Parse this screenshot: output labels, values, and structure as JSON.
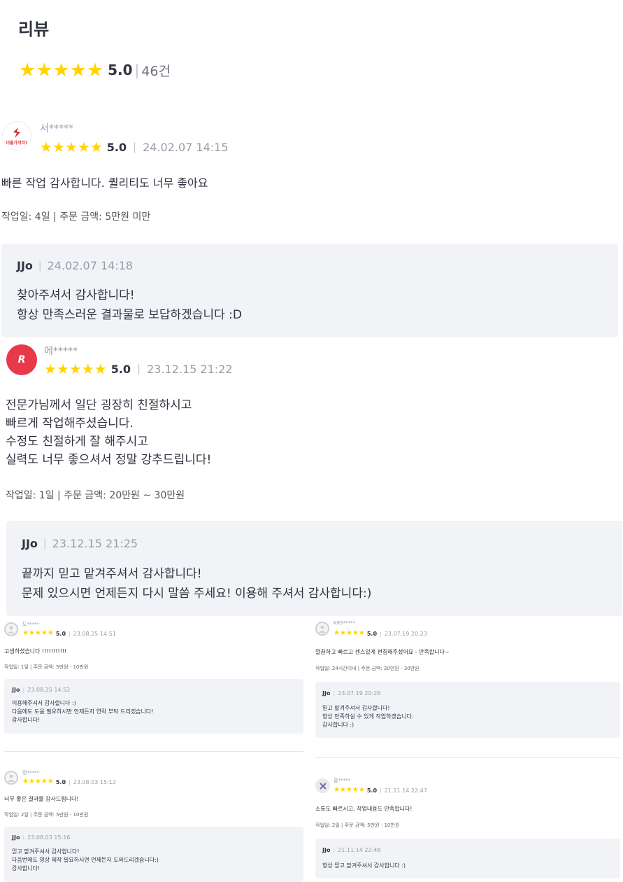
{
  "header": {
    "title": "리뷰",
    "rating": "5.0",
    "count": "46건"
  },
  "reviews": [
    {
      "user": "서*****",
      "rating": "5.0",
      "date": "24.02.07 14:15",
      "content": [
        "빠른 작업 감사합니다. 퀄리티도 너무 좋아요"
      ],
      "meta": "작업일: 4일 | 주문 금액: 5만원 미만",
      "avatar_text": "더올가치티?",
      "reply": {
        "author": "JJo",
        "date": "24.02.07 14:18",
        "content": [
          "찾아주셔서 감사합니다!",
          "항상 만족스러운 결과물로 보답하겠습니다 :D"
        ]
      }
    },
    {
      "user": "에*****",
      "rating": "5.0",
      "date": "23.12.15 21:22",
      "content": [
        "전문가님께서 일단 굉장히 친절하시고",
        "빠르게 작업해주셨습니다.",
        "수정도 친절하게 잘 해주시고",
        "실력도 너무 좋으셔서 정말 강추드립니다!"
      ],
      "meta": "작업일: 1일 | 주문 금액: 20만원 ~ 30만원",
      "avatar_text": "R",
      "reply": {
        "author": "JJo",
        "date": "23.12.15 21:25",
        "content": [
          "끝까지 믿고 맡겨주셔서 감사합니다!",
          "문제 있으시면 언제든지 다시 말씀 주세요! 이용해 주셔서 감사합니다:)"
        ]
      }
    },
    {
      "user": "도*****",
      "rating": "5.0",
      "date": "23.08.25 14:51",
      "content": [
        "고생하셨습니다 !!!!!!!!!!!"
      ],
      "meta": "작업일: 1일 | 주문 금액: 5만원 - 10만원",
      "reply": {
        "author": "JJo",
        "date": "23.08.25 14:52",
        "content": [
          "이용해주셔서 감사합니다 :)",
          "다음에도 도움 필요하시면 언제든지 연락 부탁 드리겠습니다!",
          "감사합니다!"
        ]
      }
    },
    {
      "user": "K85*****",
      "rating": "5.0",
      "date": "23.07.19 20:23",
      "content": [
        "깔끔하고 빠르고 센스있게 편집해주셨어요 - 만족합니다~"
      ],
      "meta": "작업일: 24시간이내 | 주문 금액: 20만원 - 30만원",
      "reply": {
        "author": "JJo",
        "date": "23.07.19 20:26",
        "content": [
          "믿고 맡겨주셔서 감사합니다!",
          "항상 만족하실 수 있게 작업하겠습니다.",
          "감사합니다 :)"
        ]
      }
    },
    {
      "user": "정*****",
      "rating": "5.0",
      "date": "23.08.03 15:12",
      "content": [
        "너무 좋은 결과물 감사드립니다!"
      ],
      "meta": "작업일: 2일 | 주문 금액: 5만원 - 10만원",
      "reply": {
        "author": "JJo",
        "date": "23.08.03 15:16",
        "content": [
          "믿고 맡겨주셔서 감사합니다!",
          "다음번에도 영상 제작 필요하시면 언제든지 도와드리겠습니다:)",
          "감사합니다!"
        ]
      }
    },
    {
      "user": "흠*****",
      "rating": "5.0",
      "date": "21.11.14 22:47",
      "content": [
        "소통도 빠르시고, 작업내용도 만족합니다!"
      ],
      "meta": "작업일: 2일 | 주문 금액: 5만원 - 10만원",
      "reply": {
        "author": "JJo",
        "date": "21.11.14 22:48",
        "content": [
          "항상 믿고 맡겨주셔서 감사합니다 :)"
        ]
      }
    }
  ],
  "icons": {
    "star": "star-icon",
    "separator": "|"
  },
  "colors": {
    "star": "#ffd400",
    "reply_bg": "#f2f3f7",
    "text": "#303441",
    "muted": "#9a9ba7"
  }
}
